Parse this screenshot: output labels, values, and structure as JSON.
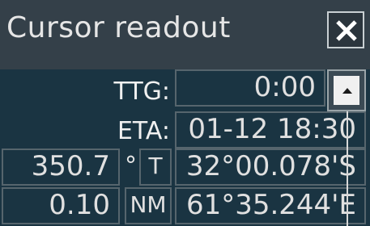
{
  "window": {
    "title": "Cursor readout"
  },
  "close_icon": "close-x-icon",
  "rows": {
    "ttg": {
      "label": "TTG:",
      "value": "0:00"
    },
    "eta": {
      "label": "ETA:",
      "value": "01-12 18:30"
    },
    "bearing": {
      "value": "350.7",
      "degree_symbol": "°",
      "unit": "T",
      "latitude": "32°00.078'S"
    },
    "range": {
      "value": "0.10",
      "unit": "NM",
      "longitude": "61°35.244'E"
    }
  },
  "up_arrow_icon": "triangle-up-icon",
  "colors": {
    "background": "#1a3442",
    "titlebar": "#344049",
    "border": "#56656d"
  }
}
